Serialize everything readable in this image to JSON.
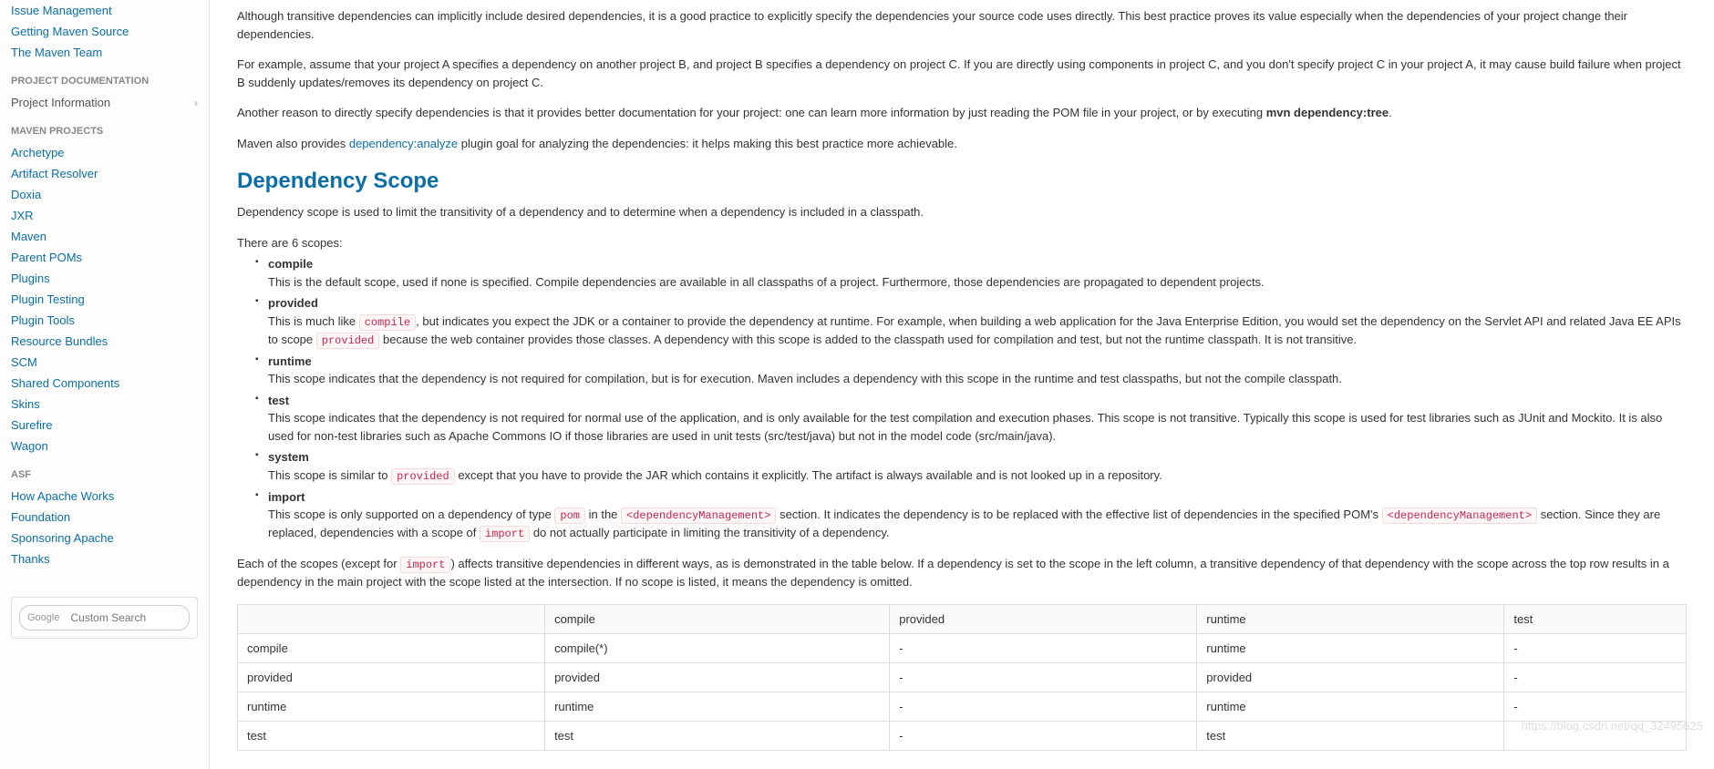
{
  "sidebar": {
    "top_links": [
      "Issue Management",
      "Getting Maven Source",
      "The Maven Team"
    ],
    "doc_title": "PROJECT DOCUMENTATION",
    "doc_item": "Project Information",
    "proj_title": "MAVEN PROJECTS",
    "proj_links": [
      "Archetype",
      "Artifact Resolver",
      "Doxia",
      "JXR",
      "Maven",
      "Parent POMs",
      "Plugins",
      "Plugin Testing",
      "Plugin Tools",
      "Resource Bundles",
      "SCM",
      "Shared Components",
      "Skins",
      "Surefire",
      "Wagon"
    ],
    "asf_title": "ASF",
    "asf_links": [
      "How Apache Works",
      "Foundation",
      "Sponsoring Apache",
      "Thanks"
    ],
    "search_brand": "Google",
    "search_placeholder": "Custom Search"
  },
  "content": {
    "p1": "Although transitive dependencies can implicitly include desired dependencies, it is a good practice to explicitly specify the dependencies your source code uses directly. This best practice proves its value especially when the dependencies of your project change their dependencies.",
    "p2": "For example, assume that your project A specifies a dependency on another project B, and project B specifies a dependency on project C. If you are directly using components in project C, and you don't specify project C in your project A, it may cause build failure when project B suddenly updates/removes its dependency on project C.",
    "p3a": "Another reason to directly specify dependencies is that it provides better documentation for your project: one can learn more information by just reading the POM file in your project, or by executing ",
    "p3b": "mvn dependency:tree",
    "p3c": ".",
    "p4a": "Maven also provides ",
    "p4link": "dependency:analyze",
    "p4b": " plugin goal for analyzing the dependencies: it helps making this best practice more achievable.",
    "heading": "Dependency Scope",
    "p5": "Dependency scope is used to limit the transitivity of a dependency and to determine when a dependency is included in a classpath.",
    "p6": "There are 6 scopes:",
    "scopes": {
      "compile": {
        "name": "compile",
        "desc": "This is the default scope, used if none is specified. Compile dependencies are available in all classpaths of a project. Furthermore, those dependencies are propagated to dependent projects."
      },
      "provided": {
        "name": "provided",
        "d1": "This is much like ",
        "c1": "compile",
        "d2": ", but indicates you expect the JDK or a container to provide the dependency at runtime. For example, when building a web application for the Java Enterprise Edition, you would set the dependency on the Servlet API and related Java EE APIs to scope ",
        "c2": "provided",
        "d3": " because the web container provides those classes. A dependency with this scope is added to the classpath used for compilation and test, but not the runtime classpath. It is not transitive."
      },
      "runtime": {
        "name": "runtime",
        "desc": "This scope indicates that the dependency is not required for compilation, but is for execution. Maven includes a dependency with this scope in the runtime and test classpaths, but not the compile classpath."
      },
      "test": {
        "name": "test",
        "desc": "This scope indicates that the dependency is not required for normal use of the application, and is only available for the test compilation and execution phases. This scope is not transitive. Typically this scope is used for test libraries such as JUnit and Mockito. It is also used for non-test libraries such as Apache Commons IO if those libraries are used in unit tests (src/test/java) but not in the model code (src/main/java)."
      },
      "system": {
        "name": "system",
        "d1": "This scope is similar to ",
        "c1": "provided",
        "d2": " except that you have to provide the JAR which contains it explicitly. The artifact is always available and is not looked up in a repository."
      },
      "import": {
        "name": "import",
        "d1": "This scope is only supported on a dependency of type ",
        "c1": "pom",
        "d2": " in the ",
        "c2": "<dependencyManagement>",
        "d3": " section. It indicates the dependency is to be replaced with the effective list of dependencies in the specified POM's ",
        "c3": "<dependencyManagement>",
        "d4": " section. Since they are replaced, dependencies with a scope of ",
        "c4": "import",
        "d5": " do not actually participate in limiting the transitivity of a dependency."
      }
    },
    "p7a": "Each of the scopes (except for ",
    "p7code": "import",
    "p7b": ") affects transitive dependencies in different ways, as is demonstrated in the table below. If a dependency is set to the scope in the left column, a transitive dependency of that dependency with the scope across the top row results in a dependency in the main project with the scope listed at the intersection. If no scope is listed, it means the dependency is omitted.",
    "table": {
      "headers": [
        "",
        "compile",
        "provided",
        "runtime",
        "test"
      ],
      "rows": [
        [
          "compile",
          "compile(*)",
          "-",
          "runtime",
          "-"
        ],
        [
          "provided",
          "provided",
          "-",
          "provided",
          "-"
        ],
        [
          "runtime",
          "runtime",
          "-",
          "runtime",
          "-"
        ],
        [
          "test",
          "test",
          "-",
          "test",
          ""
        ]
      ]
    }
  },
  "watermark": "https://blog.csdn.net/qq_32495625"
}
